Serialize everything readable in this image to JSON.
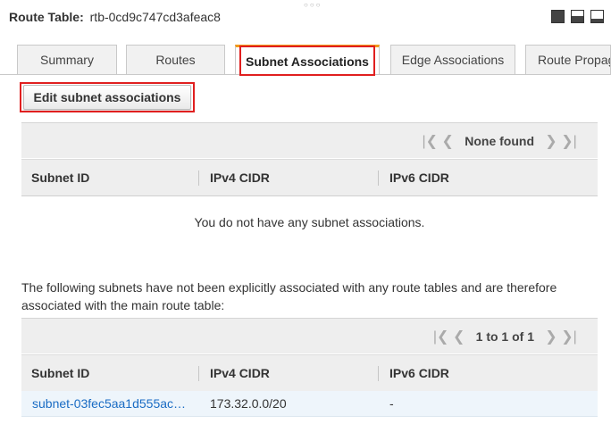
{
  "window": {
    "grip": "○○○"
  },
  "header": {
    "label": "Route Table:",
    "route_table_id": "rtb-0cd9c747cd3afeac8",
    "layout_icons": [
      "full-panel-icon",
      "split-panel-icon",
      "bottom-panel-icon"
    ]
  },
  "tabs": [
    {
      "label": "Summary",
      "active": false
    },
    {
      "label": "Routes",
      "active": false
    },
    {
      "label": "Subnet Associations",
      "active": true
    },
    {
      "label": "Edge Associations",
      "active": false
    },
    {
      "label": "Route Propaga",
      "active": false
    }
  ],
  "edit_button": {
    "label": "Edit subnet associations"
  },
  "associated_table": {
    "pager_text": "None found",
    "columns": [
      "Subnet ID",
      "IPv4 CIDR",
      "IPv6 CIDR"
    ],
    "empty_message": "You do not have any subnet associations."
  },
  "note": "The following subnets have not been explicitly associated with any route tables and are therefore associated with the main route table:",
  "unassociated_table": {
    "pager_text": "1 to 1 of 1",
    "columns": [
      "Subnet ID",
      "IPv4 CIDR",
      "IPv6 CIDR"
    ],
    "rows": [
      {
        "subnet_id": "subnet-03fec5aa1d555ac…",
        "ipv4": "173.32.0.0/20",
        "ipv6": "-"
      }
    ]
  },
  "colors": {
    "active_tab_accent": "#f29a1a",
    "highlight": "#e01f1f",
    "link": "#1a6cc4"
  }
}
